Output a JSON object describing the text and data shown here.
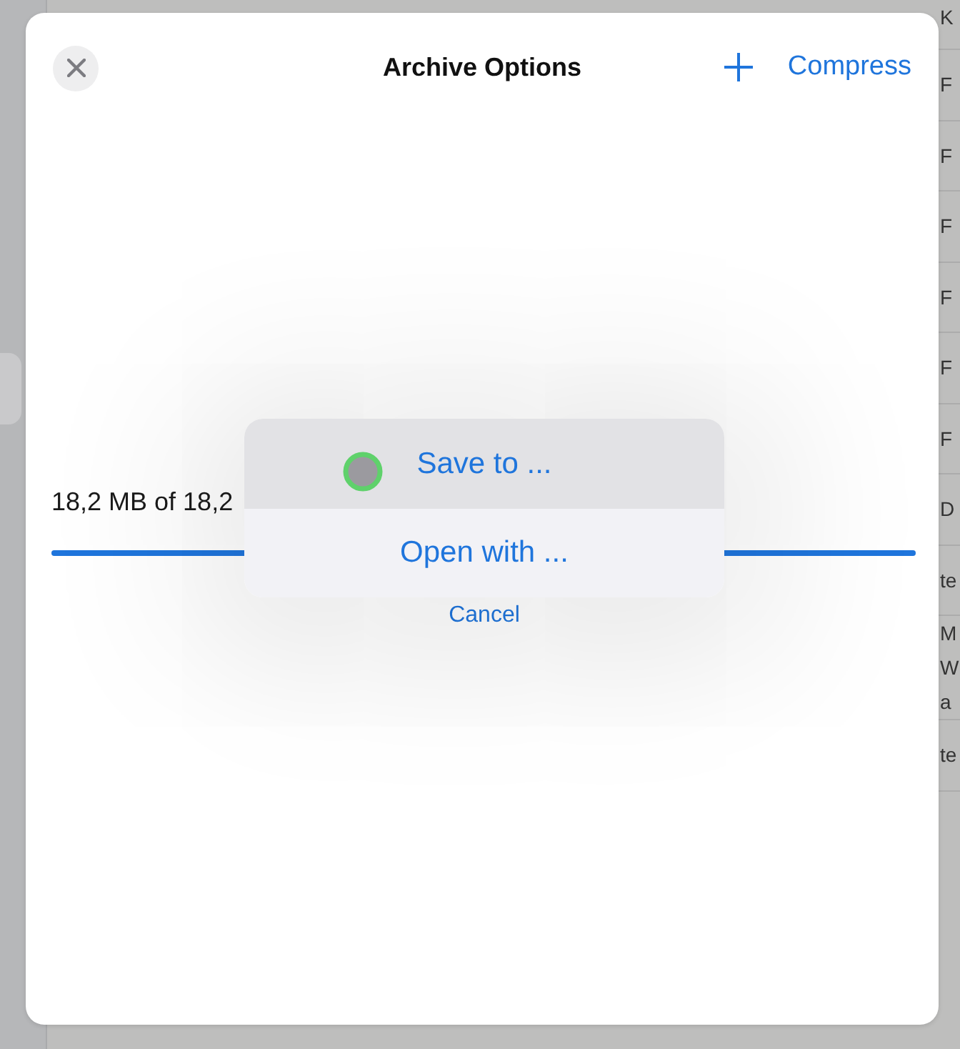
{
  "background_list": {
    "column_header": "K",
    "cells": [
      {
        "lines": [
          "F"
        ]
      },
      {
        "lines": [
          "F"
        ]
      },
      {
        "lines": [
          "F"
        ]
      },
      {
        "lines": [
          "F"
        ]
      },
      {
        "lines": [
          "F"
        ]
      },
      {
        "lines": [
          "F"
        ]
      },
      {
        "lines": [
          "D"
        ]
      },
      {
        "lines": [
          "te"
        ]
      },
      {
        "lines": [
          "M",
          "W",
          "a"
        ]
      },
      {
        "lines": [
          "te"
        ]
      }
    ]
  },
  "sheet": {
    "title": "Archive Options",
    "action": "Compress"
  },
  "progress": {
    "reading": "18,2 MB of 18,2",
    "level": 1
  },
  "action_sheet": {
    "items": [
      {
        "label": "Save to ...",
        "selected": true
      },
      {
        "label": "Open with ...",
        "selected": false
      }
    ],
    "cancel": "Cancel"
  }
}
